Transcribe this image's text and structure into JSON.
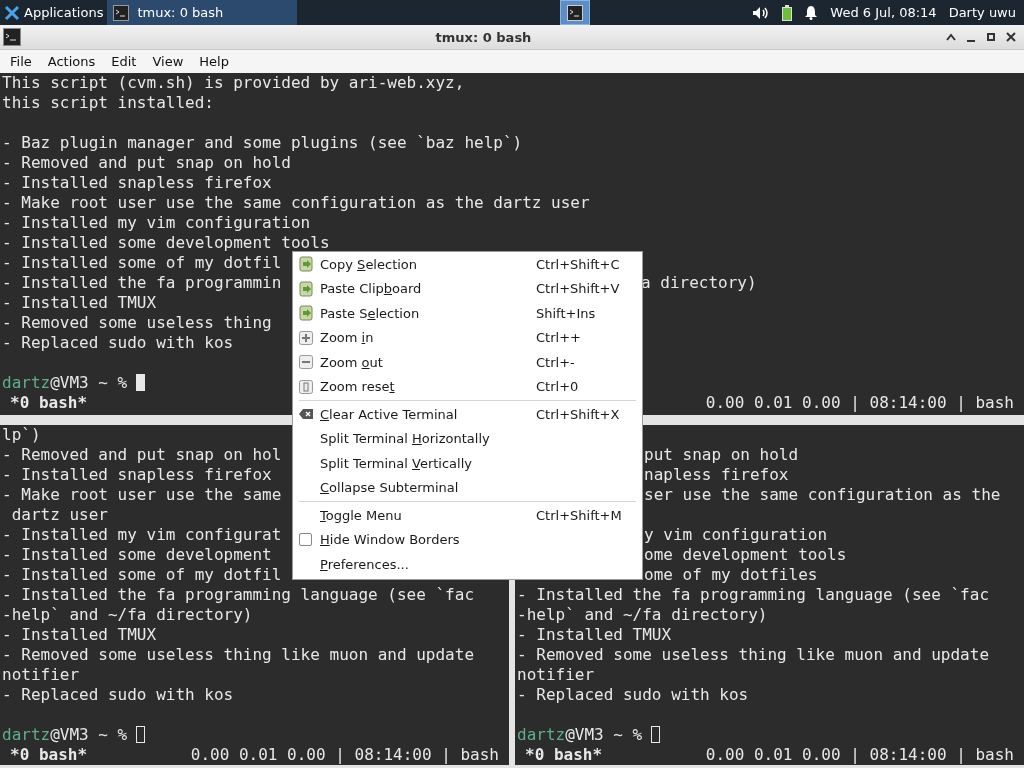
{
  "taskbar": {
    "apps_label": "Applications",
    "tasks": [
      {
        "label": "tmux: 0 bash",
        "selected": true
      }
    ],
    "workspaces": [
      {
        "selected": true
      }
    ],
    "clock": "Wed  6 Jul, 08:14",
    "user": "Darty uwu"
  },
  "window": {
    "title": "tmux: 0 bash"
  },
  "menubar": [
    "File",
    "Actions",
    "Edit",
    "View",
    "Help"
  ],
  "top_pane": {
    "lines": [
      {
        "kind": "text",
        "text": "This script (cvm.sh) is provided by ari-web.xyz,"
      },
      {
        "kind": "text",
        "text": "this script installed:"
      },
      {
        "kind": "blank"
      },
      {
        "kind": "text",
        "text": "- Baz plugin manager and some plugins (see `baz help`)"
      },
      {
        "kind": "text",
        "text": "- Removed and put snap on hold"
      },
      {
        "kind": "text",
        "text": "- Installed snapless firefox"
      },
      {
        "kind": "text",
        "text": "- Make root user use the same configuration as the dartz user"
      },
      {
        "kind": "text",
        "text": "- Installed my vim configuration"
      },
      {
        "kind": "text",
        "text": "- Installed some development tools"
      },
      {
        "kind": "text",
        "text": "- Installed some of my dotfil"
      },
      {
        "kind": "text",
        "text": "- Installed the fa programmin",
        "tail": "a directory)"
      },
      {
        "kind": "text",
        "text": "- Installed TMUX"
      },
      {
        "kind": "text",
        "text": "- Removed some useless thing"
      },
      {
        "kind": "text",
        "text": "- Replaced sudo with kos"
      },
      {
        "kind": "blank"
      },
      {
        "kind": "prompt",
        "user": "dartz",
        "rest": "@VM3 ~ %",
        "focused": true
      }
    ],
    "status": {
      "window": "*0 bash*",
      "info": "0.00 0.01 0.00 | 08:14:00 | bash"
    }
  },
  "bottom_panes": [
    {
      "lines": [
        {
          "kind": "text",
          "text": "lp`)"
        },
        {
          "kind": "text",
          "text": "- Removed and put snap on hol"
        },
        {
          "kind": "text",
          "text": "- Installed snapless firefox"
        },
        {
          "kind": "text",
          "text": "- Make root user use the same"
        },
        {
          "kind": "text",
          "text": " dartz user"
        },
        {
          "kind": "text",
          "text": "- Installed my vim configurat"
        },
        {
          "kind": "text",
          "text": "- Installed some development"
        },
        {
          "kind": "text",
          "text": "- Installed some of my dotfil"
        },
        {
          "kind": "text",
          "text": "- Installed the fa programming language (see `fac"
        },
        {
          "kind": "text",
          "text": "-help` and ~/fa directory)"
        },
        {
          "kind": "text",
          "text": "- Installed TMUX"
        },
        {
          "kind": "text",
          "text": "- Removed some useless thing like muon and update"
        },
        {
          "kind": "text",
          "text": "notifier"
        },
        {
          "kind": "text",
          "text": "- Replaced sudo with kos"
        },
        {
          "kind": "blank"
        },
        {
          "kind": "prompt",
          "user": "dartz",
          "rest": "@VM3 ~ %",
          "focused": false
        }
      ],
      "status": {
        "window": "*0 bash*",
        "info": "0.00 0.01 0.00 | 08:14:00 | bash"
      }
    },
    {
      "lines": [
        {
          "kind": "covered"
        },
        {
          "kind": "tail",
          "text": "put snap on hold"
        },
        {
          "kind": "tail",
          "text": "napless firefox"
        },
        {
          "kind": "tail",
          "text": "ser use the same configuration as the"
        },
        {
          "kind": "covered"
        },
        {
          "kind": "tail",
          "text": "y vim configuration"
        },
        {
          "kind": "tail",
          "text": "ome development tools"
        },
        {
          "kind": "tail",
          "text": "ome of my dotfiles"
        },
        {
          "kind": "text",
          "text": "- Installed the fa programming language (see `fac"
        },
        {
          "kind": "text",
          "text": "-help` and ~/fa directory)"
        },
        {
          "kind": "text",
          "text": "- Installed TMUX"
        },
        {
          "kind": "text",
          "text": "- Removed some useless thing like muon and update"
        },
        {
          "kind": "text",
          "text": "notifier"
        },
        {
          "kind": "text",
          "text": "- Replaced sudo with kos"
        },
        {
          "kind": "blank"
        },
        {
          "kind": "prompt",
          "user": "dartz",
          "rest": "@VM3 ~ %",
          "focused": false
        }
      ],
      "status": {
        "window": "*0 bash*",
        "info": "0.00 0.01 0.00 | 08:14:00 | bash"
      }
    }
  ],
  "context_menu": {
    "sections": [
      [
        {
          "kind": "copy",
          "label": {
            "before": "Copy ",
            "key": "S",
            "after": "election"
          },
          "shortcut": "Ctrl+Shift+C"
        },
        {
          "kind": "paste",
          "label": {
            "before": "Paste Clip",
            "key": "b",
            "after": "oard"
          },
          "shortcut": "Ctrl+Shift+V"
        },
        {
          "kind": "paste",
          "label": {
            "before": "Paste S",
            "key": "e",
            "after": "lection"
          },
          "shortcut": "Shift+Ins"
        },
        {
          "kind": "zoomin",
          "label": {
            "before": "Zoom ",
            "key": "i",
            "after": "n"
          },
          "shortcut": "Ctrl++"
        },
        {
          "kind": "zoomout",
          "label": {
            "before": "Zoom ",
            "key": "o",
            "after": "ut"
          },
          "shortcut": "Ctrl+-"
        },
        {
          "kind": "zoomreset",
          "label": {
            "before": "Zoom rese",
            "key": "t"
          },
          "shortcut": "Ctrl+0"
        }
      ],
      [
        {
          "kind": "clear",
          "label": {
            "key": "C",
            "after": "lear Active Terminal"
          },
          "shortcut": "Ctrl+Shift+X"
        },
        {
          "kind": "plain",
          "label": {
            "before": "Split Terminal ",
            "key": "H",
            "after": "orizontally"
          }
        },
        {
          "kind": "plain",
          "label": {
            "before": "Split Terminal ",
            "key": "V",
            "after": "ertically"
          }
        },
        {
          "kind": "plain",
          "label": {
            "key": "C",
            "after": "ollapse Subterminal"
          }
        }
      ],
      [
        {
          "kind": "plain",
          "label": {
            "key": "T",
            "after": "oggle Menu"
          },
          "shortcut": "Ctrl+Shift+M"
        },
        {
          "kind": "checkbox",
          "checked": false,
          "label": {
            "key": "H",
            "after": "ide Window Borders"
          }
        },
        {
          "kind": "plain",
          "label": {
            "key": "P",
            "after": "references..."
          }
        }
      ]
    ]
  }
}
